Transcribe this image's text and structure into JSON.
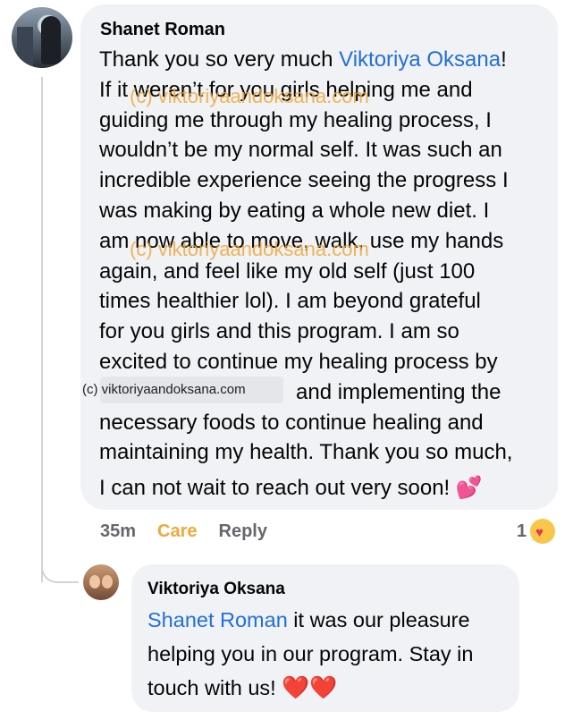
{
  "comment": {
    "author": "Shanet Roman",
    "mention": "Viktoriya Oksana",
    "lines": [
      [
        "Thank you so very much ",
        "Viktoriya Oksana",
        "!"
      ],
      [
        "If it weren’t for you girls helping me and"
      ],
      [
        "guiding me through my healing process, I"
      ],
      [
        "wouldn’t be my normal self. It was such an"
      ],
      [
        "incredible experience seeing the progress I"
      ],
      [
        "was making by eating a whole new diet. I"
      ],
      [
        "am now able to move, walk, use my hands"
      ],
      [
        "again, and feel like my old self (just 100"
      ],
      [
        "times healthier lol). I am beyond grateful"
      ],
      [
        "for you girls and this program. I am so"
      ],
      [
        "excited to continue my healing process by"
      ],
      [
        "                                   and implementing the"
      ],
      [
        "necessary foods to continue healing and"
      ],
      [
        "maintaining my health. Thank you so much,"
      ],
      [
        "I can not wait to reach out very soon! "
      ]
    ],
    "line1_prefix": "Thank you so very much ",
    "line1_suffix": "!",
    "line2": "If it weren’t for you girls helping me and",
    "line3": "guiding me through my healing process, I",
    "line4": "wouldn’t be my normal self. It was such an",
    "line5": "incredible experience seeing the progress I",
    "line6": "was making by eating a whole new diet. I",
    "line7": "am now able to move, walk, use my hands",
    "line8": "again, and feel like my old self (just 100",
    "line9": "times healthier lol). I am beyond grateful",
    "line10": "for you girls and this program. I am so",
    "line11": "excited to continue my healing process by",
    "line12": "and implementing the",
    "line13": "necessary foods to continue healing and",
    "line14": "maintaining my health. Thank you so much,",
    "line15": "I can not wait to reach out very soon! ",
    "end_emoji": "💕",
    "time": "35m",
    "reaction_label": "Care",
    "reply_label": "Reply",
    "reaction_count": "1",
    "reaction_icon": "care-emoji-icon"
  },
  "watermarks": {
    "text1": "(c) viktoriyaandoksana.com",
    "text2": "(c) viktoriyaandoksana.com",
    "text3": "(c) viktoriyaandoksana.com"
  },
  "reply": {
    "author": "Viktoriya Oksana",
    "mention": "Shanet Roman",
    "line1_suffix": " it was our pleasure",
    "line2": "helping you in our program. Stay in",
    "line3": "touch with us! ",
    "end_emoji": "❤️❤️"
  },
  "colors": {
    "bubble": "#f0f2f5",
    "mention": "#216fdb",
    "care": "#f0a83a",
    "meta": "#65676b"
  }
}
